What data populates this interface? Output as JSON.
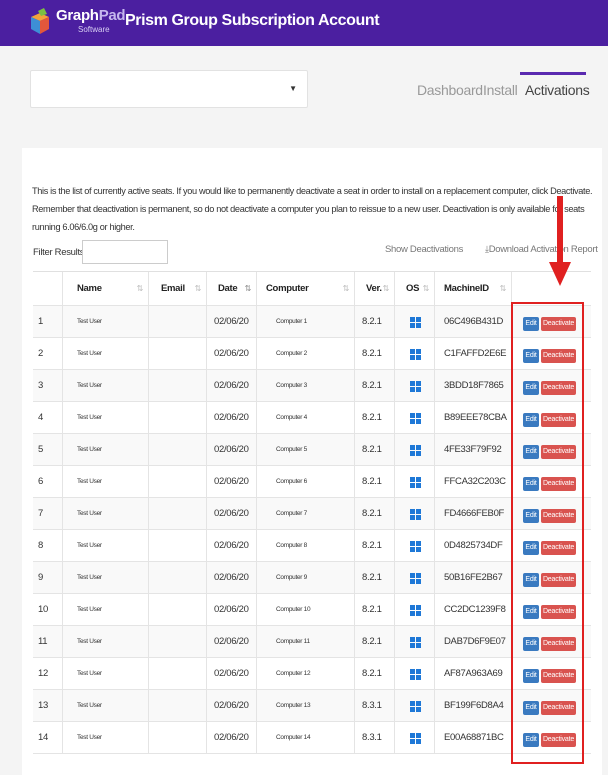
{
  "brand": {
    "name_part1": "Graph",
    "name_part2": "Pad",
    "sub": "Software",
    "app_title": "Prism Group Subscription Account"
  },
  "account_select": {
    "value": ""
  },
  "nav": {
    "tabs": [
      {
        "label": "Dashboard",
        "active": false
      },
      {
        "label": "Install",
        "active": false
      },
      {
        "label": "Activations",
        "active": true
      }
    ]
  },
  "description": "This is the list of currently active seats. If you would like to permanently deactivate a seat in order to install on a replacement computer, click Deactivate. Remember that deactivation is permanent, so do not deactivate a computer you plan to reissue to a new user. Deactivation is only available for seats running 6.06/6.0g or higher.",
  "filter": {
    "label": "Filter Results",
    "value": ""
  },
  "actions": {
    "show_deactivations": "Show Deactivations",
    "download_report": "Download Activation Report"
  },
  "table": {
    "columns": [
      "Name",
      "Email",
      "Date",
      "Computer",
      "Ver.",
      "OS",
      "MachineID"
    ],
    "edit_label": "Edit",
    "deactivate_label": "Deactivate",
    "rows": [
      {
        "num": "1",
        "name": "Test User",
        "email": "",
        "date": "02/06/20",
        "computer": "Computer 1",
        "ver": "8.2.1",
        "os": "windows-icon",
        "machine": "06C496B431D"
      },
      {
        "num": "2",
        "name": "Test User",
        "email": "",
        "date": "02/06/20",
        "computer": "Computer 2",
        "ver": "8.2.1",
        "os": "windows-icon",
        "machine": "C1FAFFD2E6E"
      },
      {
        "num": "3",
        "name": "Test User",
        "email": "",
        "date": "02/06/20",
        "computer": "Computer 3",
        "ver": "8.2.1",
        "os": "windows-icon",
        "machine": "3BDD18F7865"
      },
      {
        "num": "4",
        "name": "Test User",
        "email": "",
        "date": "02/06/20",
        "computer": "Computer 4",
        "ver": "8.2.1",
        "os": "windows-icon",
        "machine": "B89EEE78CBA"
      },
      {
        "num": "5",
        "name": "Test User",
        "email": "",
        "date": "02/06/20",
        "computer": "Computer 5",
        "ver": "8.2.1",
        "os": "windows-icon",
        "machine": "4FE33F79F92"
      },
      {
        "num": "6",
        "name": "Test User",
        "email": "",
        "date": "02/06/20",
        "computer": "Computer 6",
        "ver": "8.2.1",
        "os": "windows-icon",
        "machine": "FFCA32C203C"
      },
      {
        "num": "7",
        "name": "Test User",
        "email": "",
        "date": "02/06/20",
        "computer": "Computer 7",
        "ver": "8.2.1",
        "os": "windows-icon",
        "machine": "FD4666FEB0F"
      },
      {
        "num": "8",
        "name": "Test User",
        "email": "",
        "date": "02/06/20",
        "computer": "Computer 8",
        "ver": "8.2.1",
        "os": "windows-icon",
        "machine": "0D4825734DF"
      },
      {
        "num": "9",
        "name": "Test User",
        "email": "",
        "date": "02/06/20",
        "computer": "Computer 9",
        "ver": "8.2.1",
        "os": "windows-icon",
        "machine": "50B16FE2B67"
      },
      {
        "num": "10",
        "name": "Test User",
        "email": "",
        "date": "02/06/20",
        "computer": "Computer 10",
        "ver": "8.2.1",
        "os": "windows-icon",
        "machine": "CC2DC1239F8"
      },
      {
        "num": "11",
        "name": "Test User",
        "email": "",
        "date": "02/06/20",
        "computer": "Computer 11",
        "ver": "8.2.1",
        "os": "windows-icon",
        "machine": "DAB7D6F9E07"
      },
      {
        "num": "12",
        "name": "Test User",
        "email": "",
        "date": "02/06/20",
        "computer": "Computer 12",
        "ver": "8.2.1",
        "os": "windows-icon",
        "machine": "AF87A963A69"
      },
      {
        "num": "13",
        "name": "Test User",
        "email": "",
        "date": "02/06/20",
        "computer": "Computer 13",
        "ver": "8.3.1",
        "os": "windows-icon",
        "machine": "BF199F6D8A4"
      },
      {
        "num": "14",
        "name": "Test User",
        "email": "",
        "date": "02/06/20",
        "computer": "Computer 14",
        "ver": "8.3.1",
        "os": "windows-icon",
        "machine": "E00A68871BC"
      }
    ]
  },
  "annotation": {
    "color": "#e02020"
  }
}
